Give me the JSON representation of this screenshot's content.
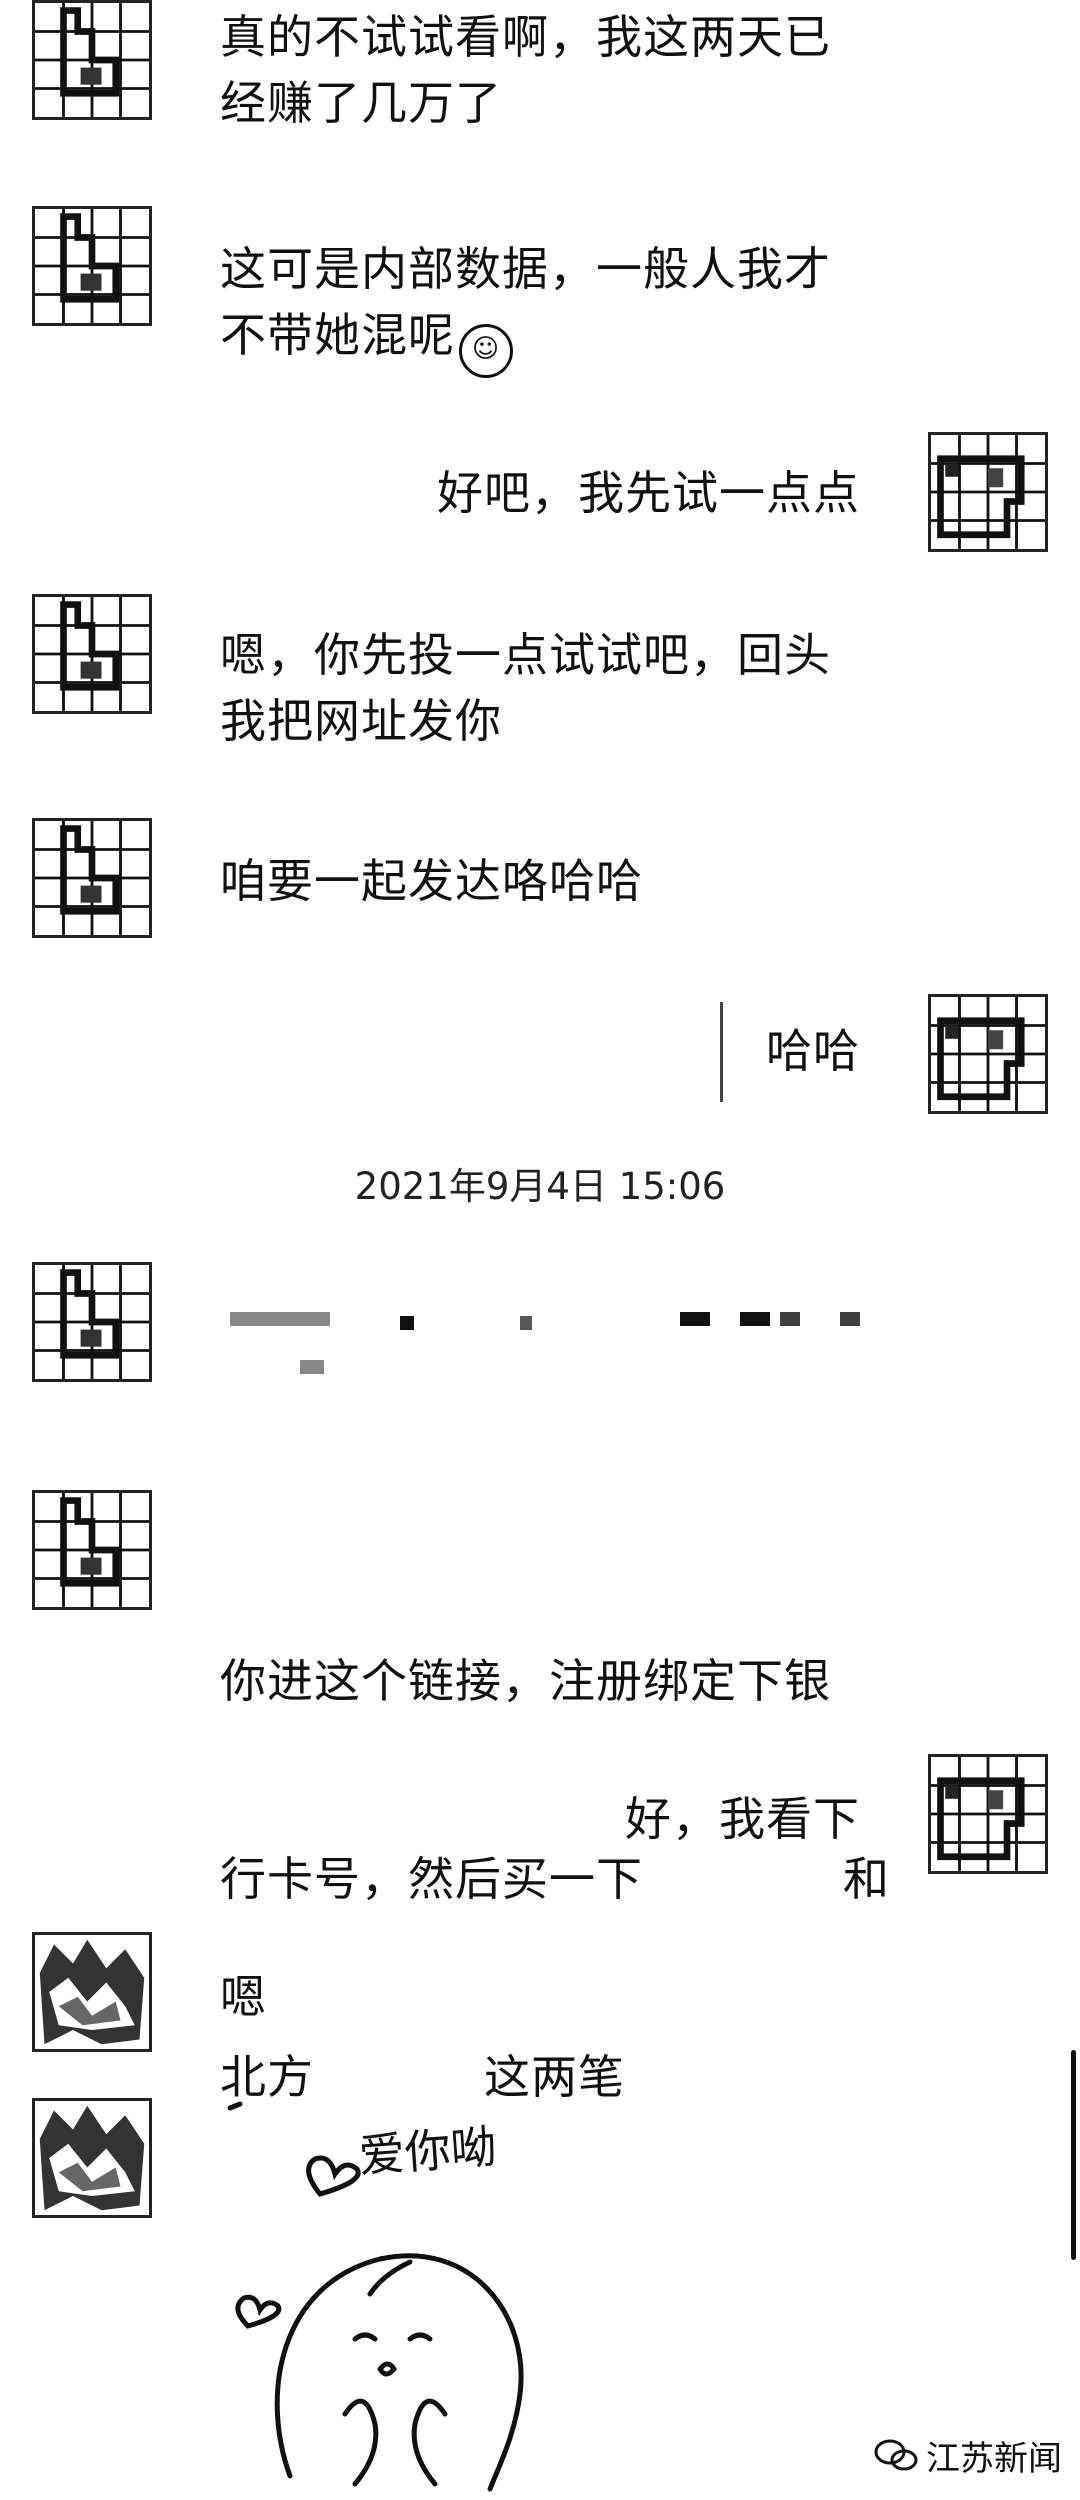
{
  "messages": {
    "m1": "真的不试试看啊，我这两天已\n经赚了几万了",
    "m2": "这可是内部数据，一般人我才\n不带她混呢",
    "m3": "好吧，我先试一点点",
    "m4": "嗯，你先投一点试试吧，回头\n我把网址发你",
    "m5": "咱要一起发达咯哈哈",
    "m6": "哈哈",
    "m8_line1": "你进这个链接，注册绑定下银",
    "m8_line2_a": "行卡号，然后买一下",
    "m8_line2_b": "和",
    "m8_line3_a": "北方",
    "m8_line3_b": "这两笔",
    "m9": "好，我看下",
    "m10": "嗯"
  },
  "timestamp": "2021年9月4日 15:06",
  "sticker": {
    "text": "爱你呦",
    "icon": "love-you-sticker"
  },
  "watermark": {
    "text": "江苏新闻",
    "icon": "wechat-logo-icon"
  },
  "colors": {
    "background": "#ffffff",
    "text": "#111111"
  }
}
